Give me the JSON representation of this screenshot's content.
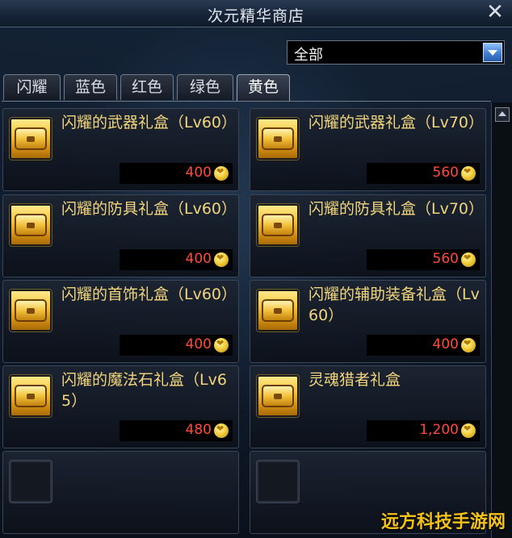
{
  "window": {
    "title": "次元精华商店",
    "close_symbol": "✕"
  },
  "filter": {
    "value": "全部"
  },
  "tabs": [
    {
      "label": "闪耀",
      "active": false
    },
    {
      "label": "蓝色",
      "active": false
    },
    {
      "label": "红色",
      "active": false
    },
    {
      "label": "绿色",
      "active": false
    },
    {
      "label": "黄色",
      "active": true
    }
  ],
  "items": [
    {
      "name": "闪耀的武器礼盒（Lv60）",
      "price": "400"
    },
    {
      "name": "闪耀的武器礼盒（Lv70）",
      "price": "560"
    },
    {
      "name": "闪耀的防具礼盒（Lv60）",
      "price": "400"
    },
    {
      "name": "闪耀的防具礼盒（Lv70）",
      "price": "560"
    },
    {
      "name": "闪耀的首饰礼盒（Lv60）",
      "price": "400"
    },
    {
      "name": "闪耀的辅助装备礼盒（Lv60）",
      "price": "400"
    },
    {
      "name": "闪耀的魔法石礼盒（Lv65）",
      "price": "480"
    },
    {
      "name": "灵魂猎者礼盒",
      "price": "1,200"
    }
  ],
  "watermark": "远方科技手游网"
}
